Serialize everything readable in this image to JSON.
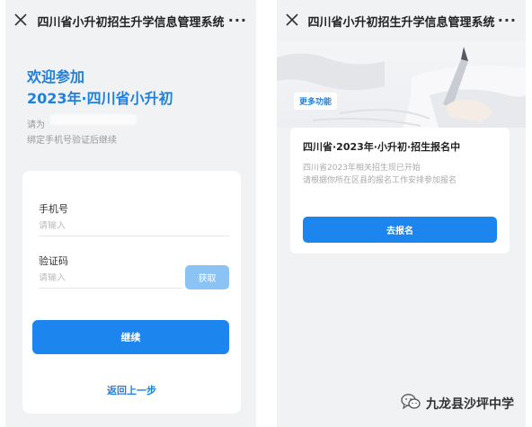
{
  "left": {
    "titlebar": {
      "title": "四川省小升初招生升学信息管理系统",
      "more": "···"
    },
    "welcome": {
      "line1": "欢迎参加",
      "line2": "2023年·四川省小升初"
    },
    "hint": {
      "please": "请为",
      "bind": "绑定手机号验证后继续"
    },
    "form": {
      "phone_label": "手机号",
      "phone_placeholder": "请输入",
      "code_label": "验证码",
      "code_placeholder": "请输入",
      "get_code": "获取",
      "continue": "继续",
      "back": "返回上一步"
    }
  },
  "right": {
    "titlebar": {
      "title": "四川省小升初招生升学信息管理系统",
      "more": "···"
    },
    "more_functions": "更多功能",
    "card": {
      "title": "四川省·2023年·小升初·招生报名中",
      "line1": "四川省2023年相关招生现已开始",
      "line2": "请根据你所在区县的报名工作安排参加报名",
      "signup": "去报名"
    }
  },
  "watermark": {
    "text": "九龙县沙坪中学",
    "icon": "wechat-icon"
  },
  "colors": {
    "accent": "#1c86ee",
    "accent_light": "#8cc3f5",
    "heading_blue": "#1f7fdb",
    "background": "#f1f2f4"
  }
}
